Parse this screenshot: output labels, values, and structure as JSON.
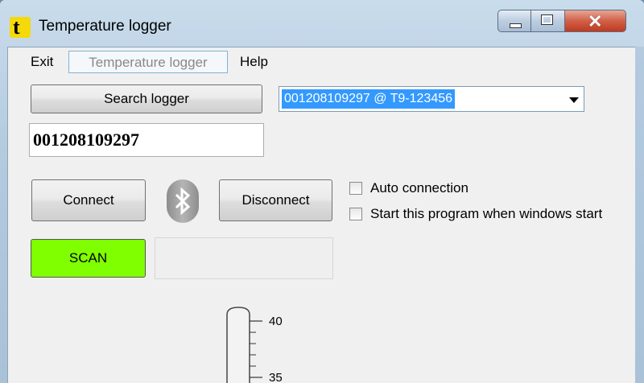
{
  "window": {
    "title": "Temperature logger",
    "app_icon_glyph": "t",
    "close_glyph": "✕"
  },
  "menu": {
    "items": [
      "Exit",
      "Temperature logger",
      "Help"
    ]
  },
  "controls": {
    "search_label": "Search logger",
    "device_selected": "001208109297 @ T9-123456",
    "serial_value": "001208109297",
    "connect_label": "Connect",
    "disconnect_label": "Disconnect",
    "scan_label": "SCAN",
    "auto_connection_label": "Auto connection",
    "start_with_windows_label": "Start this program when windows start",
    "status_text": ""
  },
  "thermometer": {
    "tick_labels": [
      "40",
      "35"
    ]
  },
  "colors": {
    "scan_button": "#80ff00",
    "selection": "#3399ff",
    "app_icon": "#f5d90a",
    "close_button": "#c0391f"
  },
  "icons": {
    "app": "app-logo-icon",
    "bluetooth": "bluetooth-icon",
    "dropdown": "chevron-down-icon"
  }
}
